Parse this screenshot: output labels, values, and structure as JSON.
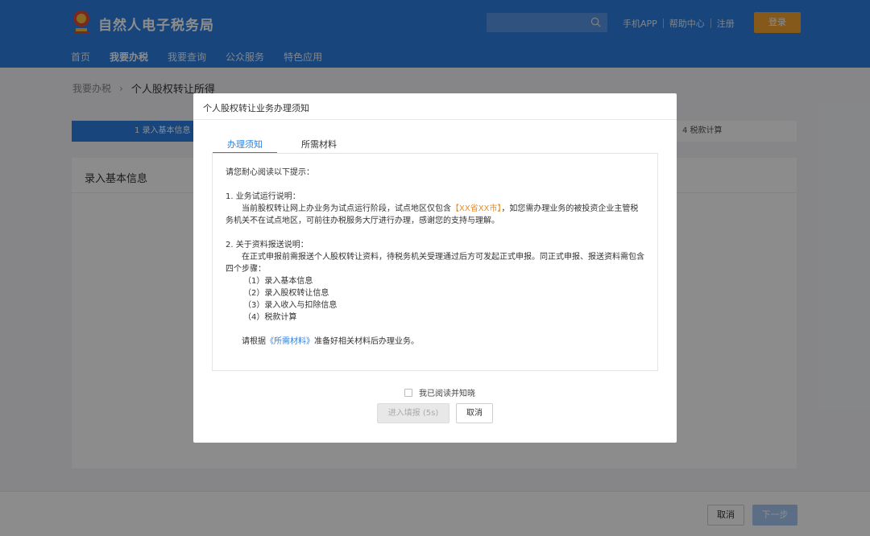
{
  "header": {
    "site_title": "自然人电子税务局",
    "search_placeholder": "",
    "links": [
      "手机APP",
      "帮助中心",
      "注册"
    ],
    "login_label": "登录",
    "nav": [
      "首页",
      "我要办税",
      "我要查询",
      "公众服务",
      "特色应用"
    ],
    "nav_active": "我要办税",
    "colors": {
      "brand": "#2c7fe0",
      "login": "#f0a330"
    }
  },
  "breadcrumb": {
    "parent": "我要办税",
    "current": "个人股权转让所得"
  },
  "steps": {
    "step1": "1  录入基本信息",
    "step4": "4  税款计算"
  },
  "panel": {
    "title": "录入基本信息"
  },
  "footer": {
    "cancel_label": "取消",
    "next_label": "下一步"
  },
  "modal": {
    "title": "个人股权转让业务办理须知",
    "tabs": [
      "办理须知",
      "所需材料"
    ],
    "intro": "请您耐心阅读以下提示：",
    "section1_title": "1. 业务试运行说明：",
    "section1_text_a": "当前股权转让网上办业务为试点运行阶段，试点地区仅包含",
    "section1_highlight": "【XX省XX市】",
    "section1_text_b": "，如您需办理业务的被投资企业主管税务机关不在试点地区，可前往办税服务大厅进行办理，感谢您的支持与理解。",
    "section2_title": "2. 关于资料报送说明：",
    "section2_text": "在正式申报前需报送个人股权转让资料，待税务机关受理通过后方可发起正式申报。同正式申报、报送资料需包含四个步骤：",
    "steps": [
      "（1）录入基本信息",
      "（2）录入股权转让信息",
      "（3）录入收入与扣除信息",
      "（4）税款计算"
    ],
    "closing_a": "请根据",
    "closing_link": "《所需材料》",
    "closing_b": "准备好相关材料后办理业务。",
    "agree_label": "我已阅读并知晓",
    "enter_label": "进入填报 (5s)",
    "cancel_label": "取消"
  }
}
